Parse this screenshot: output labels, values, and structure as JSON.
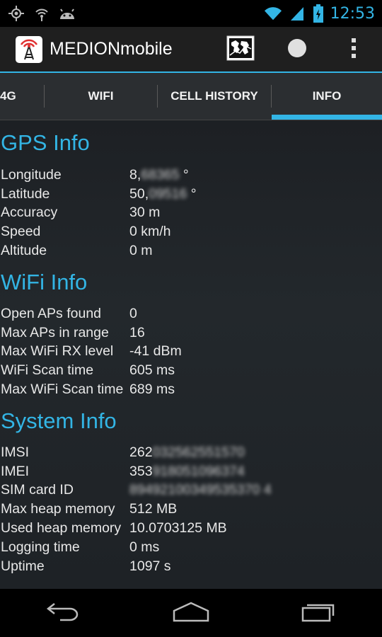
{
  "status_bar": {
    "time": "12:53",
    "left_icons": [
      "gps-icon",
      "hotspot-icon",
      "android-icon"
    ],
    "right_icons": [
      "wifi-icon",
      "signal-icon",
      "battery-icon"
    ]
  },
  "action_bar": {
    "title": "MEDIONmobile",
    "actions": [
      "map-icon",
      "record-icon",
      "overflow-menu-icon"
    ]
  },
  "tabs": [
    {
      "label": "4G",
      "active": false
    },
    {
      "label": "WIFI",
      "active": false
    },
    {
      "label": "CELL HISTORY",
      "active": false
    },
    {
      "label": "INFO",
      "active": true
    }
  ],
  "sections": {
    "gps": {
      "title": "GPS Info",
      "rows": [
        {
          "label": "Longitude",
          "value_visible": "8,",
          "value_blurred": "68365",
          "unit": " °"
        },
        {
          "label": "Latitude",
          "value_visible": "50,",
          "value_blurred": "09516",
          "unit": " °"
        },
        {
          "label": "Accuracy",
          "value": "30 m"
        },
        {
          "label": "Speed",
          "value": "0 km/h"
        },
        {
          "label": "Altitude",
          "value": "0 m"
        }
      ]
    },
    "wifi": {
      "title": "WiFi Info",
      "rows": [
        {
          "label": "Open APs found",
          "value": "0"
        },
        {
          "label": "Max APs in range",
          "value": "16"
        },
        {
          "label": "Max WiFi RX level",
          "value": "-41 dBm"
        },
        {
          "label": "WiFi Scan time",
          "value": "605 ms"
        },
        {
          "label": "Max WiFi Scan time",
          "value": "689 ms"
        }
      ]
    },
    "system": {
      "title": "System Info",
      "rows": [
        {
          "label": "IMSI",
          "value_visible": "262",
          "value_blurred": "032562551570"
        },
        {
          "label": "IMEI",
          "value_visible": "353",
          "value_blurred": "918051096374"
        },
        {
          "label": "SIM card ID",
          "value_visible": "",
          "value_blurred": "89492100349535370 4"
        },
        {
          "label": "Max heap memory",
          "value": "512 MB"
        },
        {
          "label": "Used heap memory",
          "value": "10.0703125 MB"
        },
        {
          "label": "Logging time",
          "value": "0 ms"
        },
        {
          "label": "Uptime",
          "value": "1097 s"
        }
      ]
    }
  },
  "nav_bar": [
    "back-icon",
    "home-icon",
    "recent-apps-icon"
  ],
  "colors": {
    "accent": "#33b5e5",
    "tab_bg": "#2b2e31",
    "action_bar_bg": "#1f1f1f"
  }
}
